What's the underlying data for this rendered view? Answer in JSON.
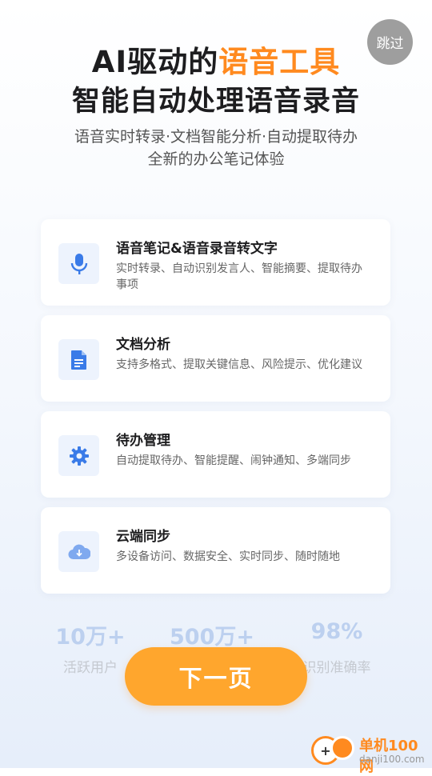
{
  "skip_label": "跳过",
  "headline": {
    "prefix": "AI驱动的",
    "highlight": "语音工具",
    "line2": "智能自动处理语音录音",
    "accent_color": "#ff8a1f"
  },
  "subtitle": {
    "line1": "语音实时转录·文档智能分析·自动提取待办",
    "line2": "全新的办公笔记体验"
  },
  "features": [
    {
      "icon": "microphone-icon",
      "title": "语音笔记&语音录音转文字",
      "desc": "实时转录、自动识别发言人、智能摘要、提取待办事项"
    },
    {
      "icon": "document-icon",
      "title": "文档分析",
      "desc": "支持多格式、提取关键信息、风险提示、优化建议"
    },
    {
      "icon": "gear-icon",
      "title": "待办管理",
      "desc": "自动提取待办、智能提醒、闹钟通知、多端同步"
    },
    {
      "icon": "cloud-download-icon",
      "title": "云端同步",
      "desc": "多设备访问、数据安全、实时同步、随时随地"
    }
  ],
  "stats": [
    {
      "value": "10万+",
      "label": "活跃用户"
    },
    {
      "value": "500万+",
      "label": ""
    },
    {
      "value": "98%",
      "label": "识别准确率"
    }
  ],
  "next_label": "下一页",
  "watermark": {
    "cn": "单机100网",
    "en": "danji100.com"
  },
  "colors": {
    "icon_blue": "#3a7be8",
    "button": "#ffa62d",
    "stat_value": "#bcd0ef"
  }
}
